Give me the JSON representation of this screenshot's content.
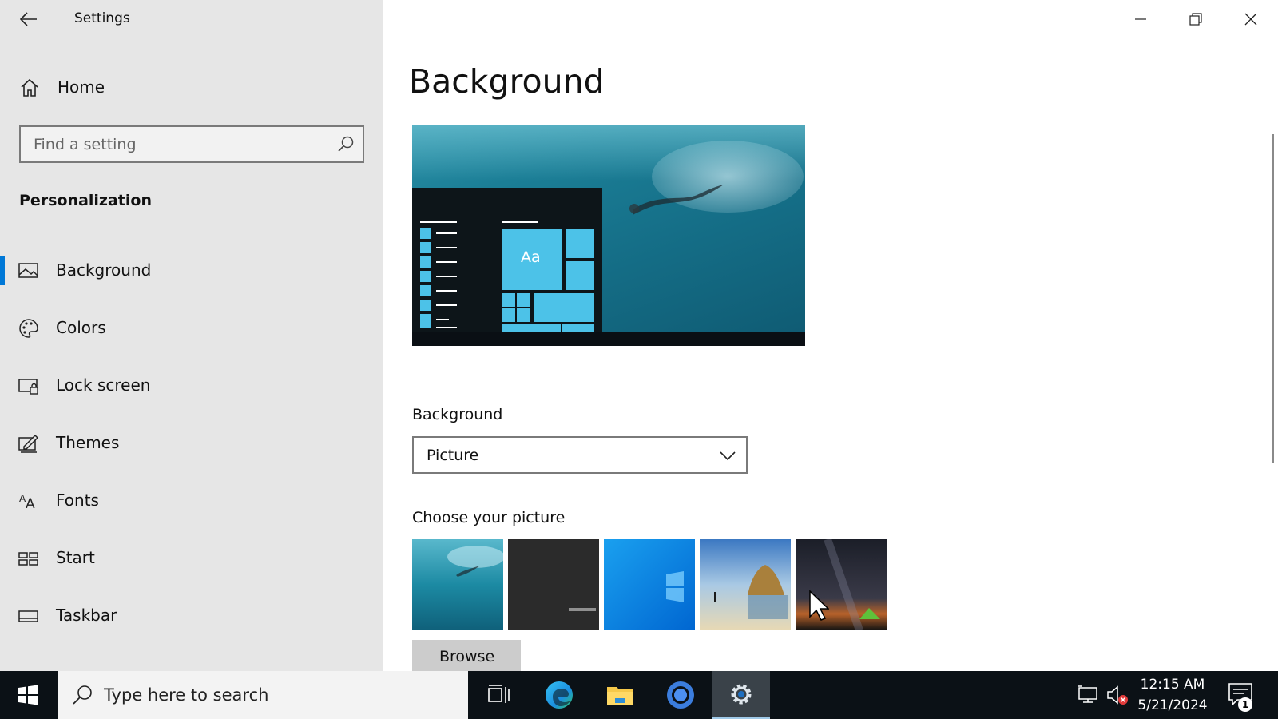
{
  "window": {
    "title": "Settings",
    "controls": [
      "minimize",
      "restore",
      "close"
    ]
  },
  "sidebar": {
    "home_label": "Home",
    "search_placeholder": "Find a setting",
    "section_title": "Personalization",
    "items": [
      {
        "label": "Background",
        "icon": "picture-icon",
        "selected": true
      },
      {
        "label": "Colors",
        "icon": "palette-icon",
        "selected": false
      },
      {
        "label": "Lock screen",
        "icon": "lock-screen-icon",
        "selected": false
      },
      {
        "label": "Themes",
        "icon": "themes-icon",
        "selected": false
      },
      {
        "label": "Fonts",
        "icon": "fonts-icon",
        "selected": false
      },
      {
        "label": "Start",
        "icon": "start-icon",
        "selected": false
      },
      {
        "label": "Taskbar",
        "icon": "taskbar-icon",
        "selected": false
      }
    ]
  },
  "main": {
    "title": "Background",
    "preview_tile_text": "Aa",
    "background_label": "Background",
    "background_value": "Picture",
    "choose_label": "Choose your picture",
    "browse_label": "Browse",
    "pictures": [
      "underwater",
      "dark",
      "windows-blue",
      "beach-rocks",
      "night-sky-tent"
    ]
  },
  "colors": {
    "accent": "#0078d7",
    "tile": "#4cc2e8",
    "sidebar_bg": "#e6e6e6",
    "taskbar_bg": "#0b1116"
  },
  "taskbar": {
    "search_placeholder": "Type here to search",
    "apps": [
      "task-view-icon",
      "edge-icon",
      "file-explorer-icon",
      "chrome-icon",
      "settings-icon"
    ],
    "time": "12:15 AM",
    "date": "5/21/2024",
    "notification_count": "1"
  }
}
